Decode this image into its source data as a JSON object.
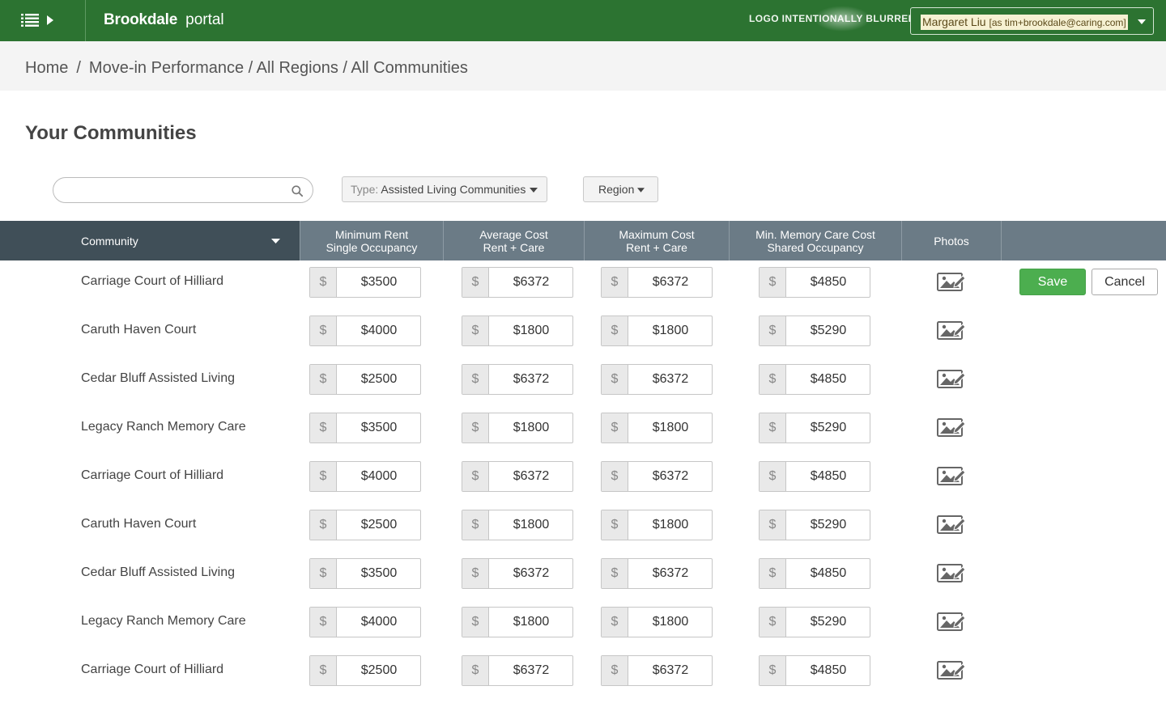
{
  "topbar": {
    "brand_name": "Brookdale",
    "brand_sub": "portal",
    "logo_text": "LOGO INTENTIONALLY BLURRED",
    "user_name": "Margaret Liu",
    "user_email": "[as tim+brookdale@caring.com]",
    "color": "#2c7331"
  },
  "breadcrumb": {
    "home": "Home",
    "path": "Move-in Performance / All Regions / All Communities"
  },
  "page": {
    "title": "Your Communities"
  },
  "filters": {
    "search_placeholder": "",
    "type_prefix": "Type:",
    "type_value": "Assisted Living Communities",
    "region_label": "Region"
  },
  "table": {
    "headers": {
      "community": "Community",
      "min_rent_1": "Minimum Rent",
      "min_rent_2": "Single Occupancy",
      "avg_cost_1": "Average Cost",
      "avg_cost_2": "Rent + Care",
      "max_cost_1": "Maximum Cost",
      "max_cost_2": "Rent + Care",
      "mem_cost_1": "Min. Memory Care Cost",
      "mem_cost_2": "Shared Occupancy",
      "photos": "Photos"
    },
    "currency_symbol": "$",
    "rows": [
      {
        "name": "Carriage Court of Hilliard",
        "min": "$3500",
        "avg": "$6372",
        "max": "$6372",
        "mem": "$4850"
      },
      {
        "name": "Caruth Haven Court",
        "min": "$4000",
        "avg": "$1800",
        "max": "$1800",
        "mem": "$5290"
      },
      {
        "name": "Cedar Bluff Assisted Living",
        "min": "$2500",
        "avg": "$6372",
        "max": "$6372",
        "mem": "$4850"
      },
      {
        "name": "Legacy Ranch Memory Care",
        "min": "$3500",
        "avg": "$1800",
        "max": "$1800",
        "mem": "$5290"
      },
      {
        "name": "Carriage Court of Hilliard",
        "min": "$4000",
        "avg": "$6372",
        "max": "$6372",
        "mem": "$4850"
      },
      {
        "name": "Caruth Haven Court",
        "min": "$2500",
        "avg": "$1800",
        "max": "$1800",
        "mem": "$5290"
      },
      {
        "name": "Cedar Bluff Assisted Living",
        "min": "$3500",
        "avg": "$6372",
        "max": "$6372",
        "mem": "$4850"
      },
      {
        "name": "Legacy Ranch Memory Care",
        "min": "$4000",
        "avg": "$1800",
        "max": "$1800",
        "mem": "$5290"
      },
      {
        "name": "Carriage Court of Hilliard",
        "min": "$2500",
        "avg": "$6372",
        "max": "$6372",
        "mem": "$4850"
      }
    ]
  },
  "actions": {
    "save_label": "Save",
    "cancel_label": "Cancel",
    "save_color": "#4cae4f"
  },
  "icons": {
    "menu": "list-icon",
    "expand": "caret-right-icon",
    "search": "search-icon",
    "dropdown": "caret-down-icon",
    "photo": "photo-edit-icon"
  }
}
